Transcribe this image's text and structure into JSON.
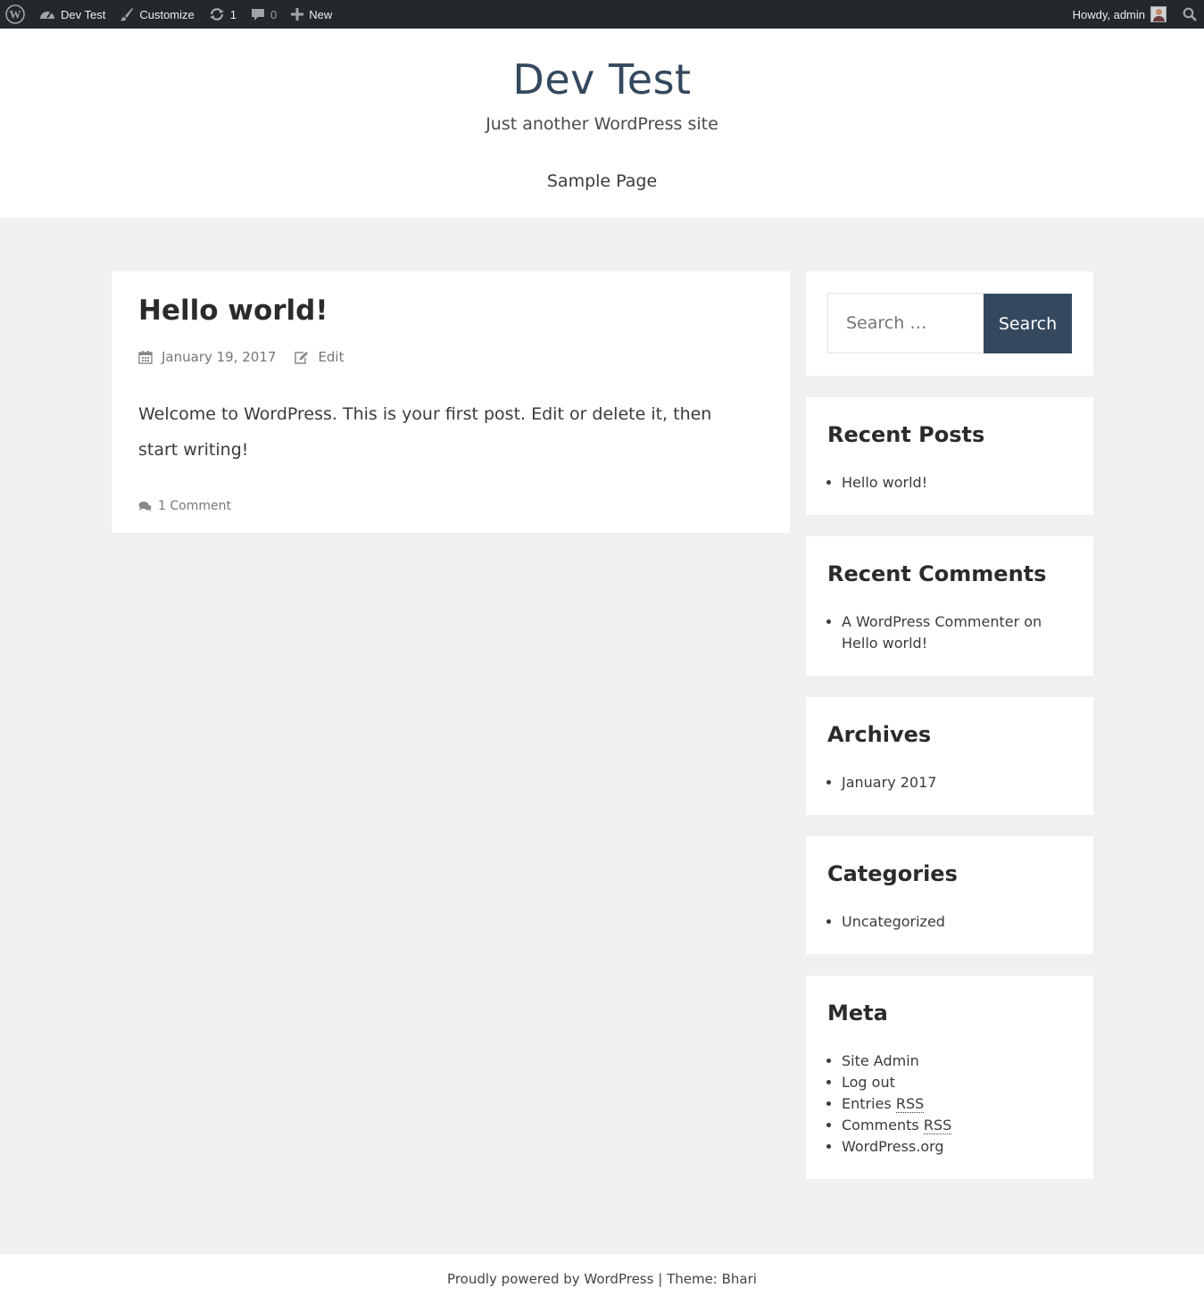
{
  "admin_bar": {
    "site_name": "Dev Test",
    "customize": "Customize",
    "updates_count": "1",
    "comments_count": "0",
    "new": "New",
    "howdy": "Howdy, admin"
  },
  "header": {
    "title": "Dev Test",
    "description": "Just another WordPress site",
    "nav": [
      "Sample Page"
    ]
  },
  "post": {
    "title": "Hello world!",
    "date": "January 19, 2017",
    "edit": "Edit",
    "content": "Welcome to WordPress. This is your first post. Edit or delete it, then start writing!",
    "comments": "1 Comment"
  },
  "sidebar": {
    "search": {
      "placeholder": "Search …",
      "button": "Search"
    },
    "recent_posts": {
      "title": "Recent Posts",
      "items": [
        "Hello world!"
      ]
    },
    "recent_comments": {
      "title": "Recent Comments",
      "author": "A WordPress Commenter",
      "on": "on",
      "post": "Hello world!"
    },
    "archives": {
      "title": "Archives",
      "items": [
        "January 2017"
      ]
    },
    "categories": {
      "title": "Categories",
      "items": [
        "Uncategorized"
      ]
    },
    "meta": {
      "title": "Meta",
      "site_admin": "Site Admin",
      "log_out": "Log out",
      "entries": "Entries",
      "comments": "Comments",
      "rss": "RSS",
      "wordpress_org": "WordPress.org"
    }
  },
  "footer": {
    "powered": "Proudly powered by WordPress",
    "separator": "|",
    "theme": "Theme: Bhari"
  },
  "colors": {
    "admin_bar": "#23282d",
    "accent": "#34495e",
    "page_bg": "#f0f0f0"
  }
}
